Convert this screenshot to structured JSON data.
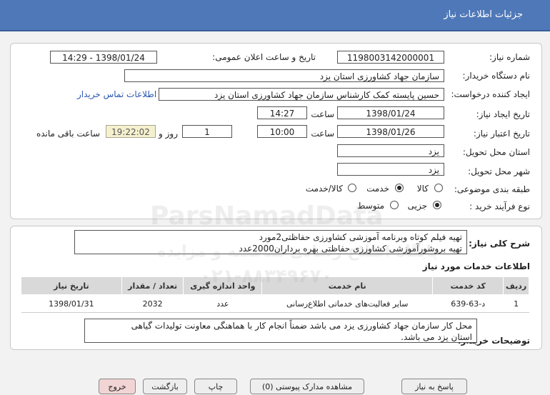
{
  "header": {
    "title": "جزئیات اطلاعات نیاز"
  },
  "fields": {
    "need_number_label": "شماره نیاز:",
    "need_number": "1198003142000001",
    "announce_label": "تاریخ و ساعت اعلان عمومی:",
    "announce_value": "1398/01/24 - 14:29",
    "buyer_org_label": "نام دستگاه خریدار:",
    "buyer_org": "سازمان جهاد کشاورزی استان یزد",
    "requester_label": "ایجاد کننده درخواست:",
    "requester": "حسین پایسته کمک کارشناس سازمان جهاد کشاورزی استان یزد",
    "contact_link": "اطلاعات تماس خریدار",
    "created_label": "تاریخ ایجاد نیاز:",
    "created_date": "1398/01/24",
    "time_label": "ساعت",
    "created_time": "14:27",
    "validity_label": "تاریخ اعتبار نیاز:",
    "validity_date": "1398/01/26",
    "validity_time": "10:00",
    "days_value": "1",
    "days_label": "روز و",
    "remaining_time": "19:22:02",
    "remaining_label": "ساعت باقی مانده",
    "delivery_province_label": "استان محل تحویل:",
    "delivery_province": "یزد",
    "delivery_city_label": "شهر محل تحویل:",
    "delivery_city": "یزد",
    "category_label": "طبقه بندی موضوعی:",
    "category_options": [
      "کالا",
      "خدمت",
      "کالا/خدمت"
    ],
    "process_label": "نوع فرآیند خرید :",
    "process_options": [
      "جزیی",
      "متوسط"
    ]
  },
  "summary": {
    "label": "شرح کلی نیاز:",
    "line1": "تهیه فیلم کوتاه وبرنامه آموزشی کشاورزی حفاظتی2مورد",
    "line2": "تهیه بروشورآموزشی کشاورزی حفاظتی بهره برداران2000عدد"
  },
  "services": {
    "title": "اطلاعات خدمات مورد نیاز",
    "headers": [
      "ردیف",
      "کد خدمت",
      "نام خدمت",
      "واحد اندازه گیری",
      "تعداد / مقدار",
      "تاریخ نیاز"
    ],
    "rows": [
      [
        "1",
        "د-63-639",
        "سایر فعالیت‌های خدماتی اطلاع‌رسانی",
        "عدد",
        "2032",
        "1398/01/31"
      ]
    ]
  },
  "buyer_notes": {
    "label": "توضیحات خریدار:",
    "line1": "محل کار سازمان جهاد کشاورزی یزد می باشد ضمناً انجام کار با هماهنگی معاونت تولیدات گیاهی",
    "line2": "استان یزد می باشد."
  },
  "buttons": [
    "پاسخ به نیاز",
    "مشاهده مدارک پیوستی (0)",
    "چاپ",
    "بازگشت",
    "خروج"
  ],
  "watermark": {
    "brand": "ParsNamadData",
    "phone": "۰۲۱-۸۸۳۴۹۶۷۰",
    "text": "پایگاه اطلاع رسانی مناقصه و مزایده"
  },
  "colors": {
    "header_bg": "#4f78b8",
    "highlight": "#f5f1cf",
    "link": "#2a58b0"
  }
}
